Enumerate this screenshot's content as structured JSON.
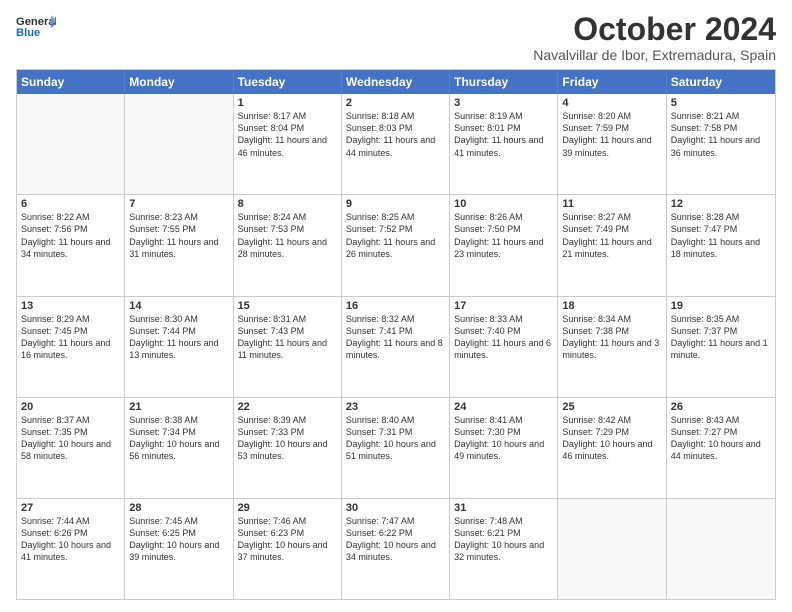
{
  "header": {
    "title": "October 2024",
    "subtitle": "Navalvillar de Ibor, Extremadura, Spain",
    "logo_line1": "General",
    "logo_line2": "Blue"
  },
  "days_of_week": [
    "Sunday",
    "Monday",
    "Tuesday",
    "Wednesday",
    "Thursday",
    "Friday",
    "Saturday"
  ],
  "weeks": [
    [
      {
        "day": "",
        "info": ""
      },
      {
        "day": "",
        "info": ""
      },
      {
        "day": "1",
        "info": "Sunrise: 8:17 AM\nSunset: 8:04 PM\nDaylight: 11 hours and 46 minutes."
      },
      {
        "day": "2",
        "info": "Sunrise: 8:18 AM\nSunset: 8:03 PM\nDaylight: 11 hours and 44 minutes."
      },
      {
        "day": "3",
        "info": "Sunrise: 8:19 AM\nSunset: 8:01 PM\nDaylight: 11 hours and 41 minutes."
      },
      {
        "day": "4",
        "info": "Sunrise: 8:20 AM\nSunset: 7:59 PM\nDaylight: 11 hours and 39 minutes."
      },
      {
        "day": "5",
        "info": "Sunrise: 8:21 AM\nSunset: 7:58 PM\nDaylight: 11 hours and 36 minutes."
      }
    ],
    [
      {
        "day": "6",
        "info": "Sunrise: 8:22 AM\nSunset: 7:56 PM\nDaylight: 11 hours and 34 minutes."
      },
      {
        "day": "7",
        "info": "Sunrise: 8:23 AM\nSunset: 7:55 PM\nDaylight: 11 hours and 31 minutes."
      },
      {
        "day": "8",
        "info": "Sunrise: 8:24 AM\nSunset: 7:53 PM\nDaylight: 11 hours and 28 minutes."
      },
      {
        "day": "9",
        "info": "Sunrise: 8:25 AM\nSunset: 7:52 PM\nDaylight: 11 hours and 26 minutes."
      },
      {
        "day": "10",
        "info": "Sunrise: 8:26 AM\nSunset: 7:50 PM\nDaylight: 11 hours and 23 minutes."
      },
      {
        "day": "11",
        "info": "Sunrise: 8:27 AM\nSunset: 7:49 PM\nDaylight: 11 hours and 21 minutes."
      },
      {
        "day": "12",
        "info": "Sunrise: 8:28 AM\nSunset: 7:47 PM\nDaylight: 11 hours and 18 minutes."
      }
    ],
    [
      {
        "day": "13",
        "info": "Sunrise: 8:29 AM\nSunset: 7:45 PM\nDaylight: 11 hours and 16 minutes."
      },
      {
        "day": "14",
        "info": "Sunrise: 8:30 AM\nSunset: 7:44 PM\nDaylight: 11 hours and 13 minutes."
      },
      {
        "day": "15",
        "info": "Sunrise: 8:31 AM\nSunset: 7:43 PM\nDaylight: 11 hours and 11 minutes."
      },
      {
        "day": "16",
        "info": "Sunrise: 8:32 AM\nSunset: 7:41 PM\nDaylight: 11 hours and 8 minutes."
      },
      {
        "day": "17",
        "info": "Sunrise: 8:33 AM\nSunset: 7:40 PM\nDaylight: 11 hours and 6 minutes."
      },
      {
        "day": "18",
        "info": "Sunrise: 8:34 AM\nSunset: 7:38 PM\nDaylight: 11 hours and 3 minutes."
      },
      {
        "day": "19",
        "info": "Sunrise: 8:35 AM\nSunset: 7:37 PM\nDaylight: 11 hours and 1 minute."
      }
    ],
    [
      {
        "day": "20",
        "info": "Sunrise: 8:37 AM\nSunset: 7:35 PM\nDaylight: 10 hours and 58 minutes."
      },
      {
        "day": "21",
        "info": "Sunrise: 8:38 AM\nSunset: 7:34 PM\nDaylight: 10 hours and 56 minutes."
      },
      {
        "day": "22",
        "info": "Sunrise: 8:39 AM\nSunset: 7:33 PM\nDaylight: 10 hours and 53 minutes."
      },
      {
        "day": "23",
        "info": "Sunrise: 8:40 AM\nSunset: 7:31 PM\nDaylight: 10 hours and 51 minutes."
      },
      {
        "day": "24",
        "info": "Sunrise: 8:41 AM\nSunset: 7:30 PM\nDaylight: 10 hours and 49 minutes."
      },
      {
        "day": "25",
        "info": "Sunrise: 8:42 AM\nSunset: 7:29 PM\nDaylight: 10 hours and 46 minutes."
      },
      {
        "day": "26",
        "info": "Sunrise: 8:43 AM\nSunset: 7:27 PM\nDaylight: 10 hours and 44 minutes."
      }
    ],
    [
      {
        "day": "27",
        "info": "Sunrise: 7:44 AM\nSunset: 6:26 PM\nDaylight: 10 hours and 41 minutes."
      },
      {
        "day": "28",
        "info": "Sunrise: 7:45 AM\nSunset: 6:25 PM\nDaylight: 10 hours and 39 minutes."
      },
      {
        "day": "29",
        "info": "Sunrise: 7:46 AM\nSunset: 6:23 PM\nDaylight: 10 hours and 37 minutes."
      },
      {
        "day": "30",
        "info": "Sunrise: 7:47 AM\nSunset: 6:22 PM\nDaylight: 10 hours and 34 minutes."
      },
      {
        "day": "31",
        "info": "Sunrise: 7:48 AM\nSunset: 6:21 PM\nDaylight: 10 hours and 32 minutes."
      },
      {
        "day": "",
        "info": ""
      },
      {
        "day": "",
        "info": ""
      }
    ]
  ]
}
